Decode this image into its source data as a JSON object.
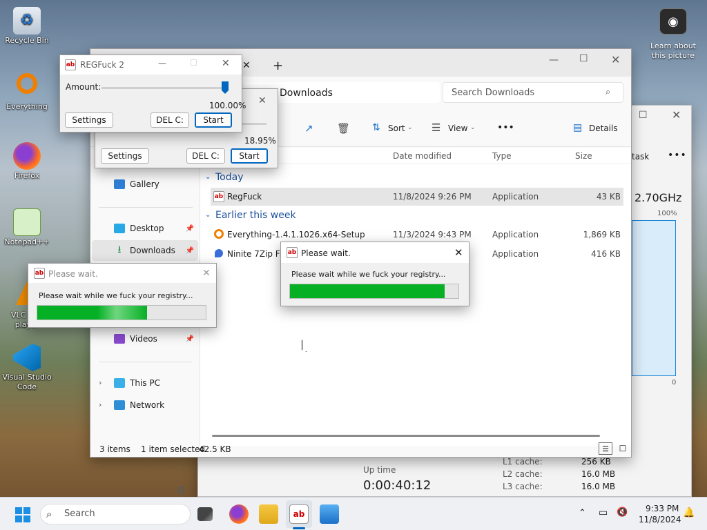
{
  "desktop": {
    "icons": [
      {
        "label": "Recycle Bin"
      },
      {
        "label": "Everything"
      },
      {
        "label": "Firefox"
      },
      {
        "label": "Notepad++"
      },
      {
        "label": "VLC m... player"
      },
      {
        "label": "Visual Studio Code"
      }
    ],
    "spotlight_label": "Learn about this picture"
  },
  "taskmgr": {
    "speed": "2.70GHz",
    "percent_top": "100%",
    "percent_bottom": "0",
    "tab_fragment": "task",
    "uptime_label": "Up time",
    "uptime_value": "0:00:40:12",
    "cache": [
      {
        "label": "L1 cache:",
        "value": "256 KB"
      },
      {
        "label": "L2 cache:",
        "value": "16.0 MB"
      },
      {
        "label": "L3 cache:",
        "value": "16.0 MB"
      }
    ]
  },
  "explorer": {
    "new_tab": "+",
    "breadcrumb": "Downloads",
    "search_placeholder": "Search Downloads",
    "toolbar": {
      "sort": "Sort",
      "view": "View",
      "more": "•••",
      "details": "Details"
    },
    "nav": [
      {
        "label": "Gallery"
      },
      {
        "label": "Desktop"
      },
      {
        "label": "Downloads"
      },
      {
        "label": "Videos"
      },
      {
        "label": "This PC"
      },
      {
        "label": "Network"
      }
    ],
    "columns": {
      "date": "Date modified",
      "type": "Type",
      "size": "Size"
    },
    "groups": {
      "today": "Today",
      "earlier": "Earlier this week"
    },
    "files": [
      {
        "name": "RegFuck",
        "date": "11/8/2024 9:26 PM",
        "type": "Application",
        "size": "43 KB"
      },
      {
        "name": "Everything-1.4.1.1026.x64-Setup",
        "date": "11/3/2024 9:43 PM",
        "type": "Application",
        "size": "1,869 KB"
      },
      {
        "name": "Ninite 7Zip Fire",
        "date": "",
        "type": "Application",
        "size": "416 KB"
      }
    ],
    "status": {
      "items": "3 items",
      "selected": "1 item selected",
      "size": "42.5 KB"
    }
  },
  "regfuck_front": {
    "title": "REGFuck 2",
    "amount_label": "Amount:",
    "amount_value": "100.00%",
    "amount": 1.0,
    "settings": "Settings",
    "del": "DEL C:",
    "start": "Start"
  },
  "regfuck_back": {
    "amount_value": "18.95%",
    "amount": 0.1895,
    "settings": "Settings",
    "del": "DEL C:",
    "start": "Start"
  },
  "wait_left": {
    "title": "Please wait.",
    "message": "Please wait while we fuck your registry...",
    "progress": 0.65
  },
  "wait_center": {
    "title": "Please wait.",
    "message": "Please wait while we fuck your registry...",
    "progress": 0.92
  },
  "taskbar": {
    "search": "Search",
    "time": "9:33 PM",
    "date": "11/8/2024"
  }
}
